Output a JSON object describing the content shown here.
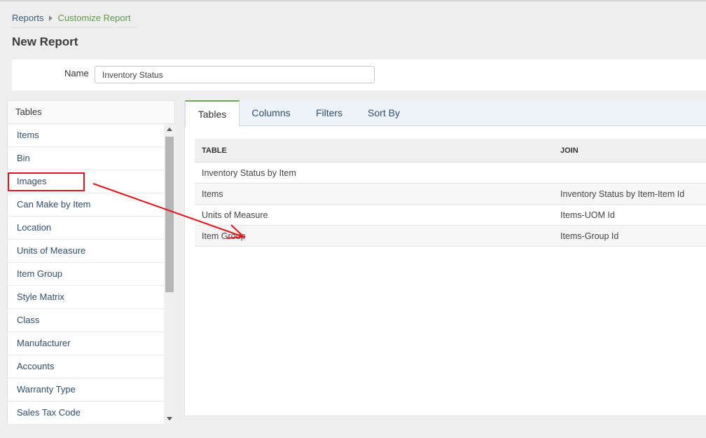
{
  "breadcrumb": {
    "reports": "Reports",
    "current": "Customize Report"
  },
  "page_title": "New Report",
  "name_field": {
    "label": "Name",
    "value": "Inventory Status"
  },
  "tables_panel": {
    "header": "Tables",
    "items": [
      "Items",
      "Bin",
      "Images",
      "Can Make by Item",
      "Location",
      "Units of Measure",
      "Item Group",
      "Style Matrix",
      "Class",
      "Manufacturer",
      "Accounts",
      "Warranty Type",
      "Sales Tax Code"
    ]
  },
  "tabs": {
    "tables": "Tables",
    "columns": "Columns",
    "filters": "Filters",
    "sort_by": "Sort By"
  },
  "grid": {
    "headers": {
      "table": "TABLE",
      "join": "JOIN"
    },
    "rows": [
      {
        "table": "Inventory Status by Item",
        "join": ""
      },
      {
        "table": "Items",
        "join": "Inventory Status by Item-Item Id"
      },
      {
        "table": "Units of Measure",
        "join": "Items-UOM Id"
      },
      {
        "table": "Item Group",
        "join": "Items-Group Id"
      }
    ]
  },
  "colors": {
    "accent_green": "#6aa84f",
    "link_blue": "#2e4d70",
    "annotation_red": "#e0141b"
  },
  "icons": [
    "breadcrumb-chevron-icon",
    "scroll-up-icon",
    "scroll-down-icon"
  ]
}
